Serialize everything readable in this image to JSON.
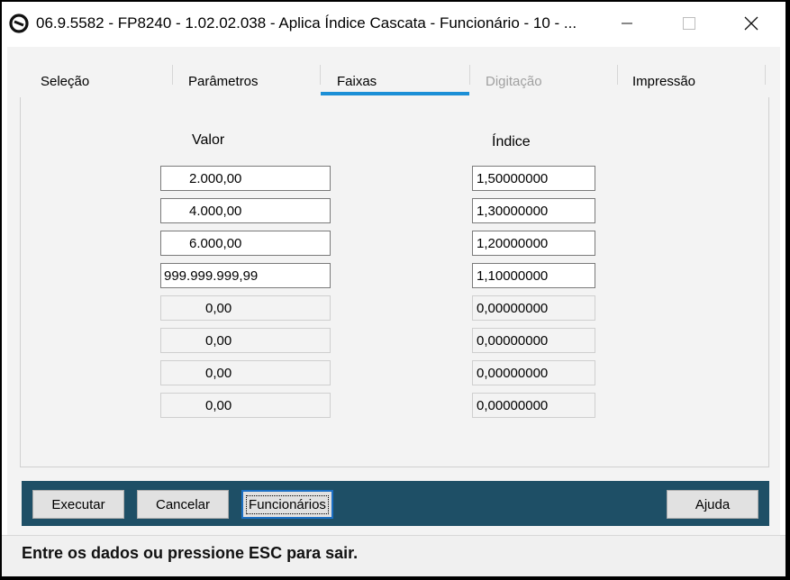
{
  "window": {
    "title": "06.9.5582 - FP8240 - 1.02.02.038 - Aplica Índice Cascata - Funcionário - 10 - ...",
    "app_icon": "circle-logo-icon",
    "controls": {
      "minimize": "minimize-icon",
      "maximize": "maximize-icon",
      "close": "close-icon"
    }
  },
  "tabs": [
    {
      "label": "Seleção",
      "state": "normal"
    },
    {
      "label": "Parâmetros",
      "state": "normal"
    },
    {
      "label": "Faixas",
      "state": "active"
    },
    {
      "label": "Digitação",
      "state": "disabled"
    },
    {
      "label": "Impressão",
      "state": "normal"
    }
  ],
  "columns": {
    "valor": "Valor",
    "indice": "Índice"
  },
  "rows": [
    {
      "valor": "2.000,00",
      "indice": "1,50000000",
      "filled": true
    },
    {
      "valor": "4.000,00",
      "indice": "1,30000000",
      "filled": true
    },
    {
      "valor": "6.000,00",
      "indice": "1,20000000",
      "filled": true
    },
    {
      "valor": "999.999.999,99",
      "indice": "1,10000000",
      "filled": true
    },
    {
      "valor": "0,00",
      "indice": "0,00000000",
      "filled": false
    },
    {
      "valor": "0,00",
      "indice": "0,00000000",
      "filled": false
    },
    {
      "valor": "0,00",
      "indice": "0,00000000",
      "filled": false
    },
    {
      "valor": "0,00",
      "indice": "0,00000000",
      "filled": false
    }
  ],
  "buttons": {
    "executar": "Executar",
    "cancelar": "Cancelar",
    "funcionarios": "Funcionários",
    "ajuda": "Ajuda"
  },
  "status": "Entre os dados ou pressione ESC para sair.",
  "colors": {
    "accent": "#1b8fd6",
    "button_bar": "#1e4f66",
    "focus": "#1b6fc4"
  }
}
